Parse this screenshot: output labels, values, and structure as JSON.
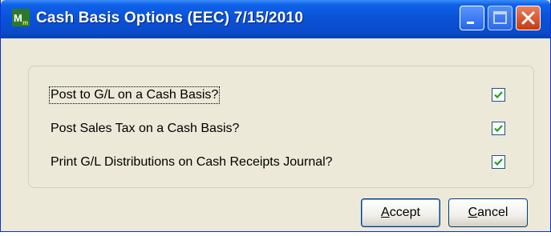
{
  "window": {
    "title": "Cash Basis Options (EEC) 7/15/2010",
    "icon": "mas-app-icon"
  },
  "options": [
    {
      "label": "Post to G/L on a Cash Basis?",
      "checked": true
    },
    {
      "label": "Post Sales Tax on a Cash Basis?",
      "checked": true
    },
    {
      "label": "Print G/L Distributions on Cash Receipts Journal?",
      "checked": true
    }
  ],
  "buttons": {
    "accept": {
      "mnemonic": "A",
      "rest": "ccept"
    },
    "cancel": {
      "mnemonic": "C",
      "rest": "ancel"
    }
  },
  "colors": {
    "titlebar": "#0a52d8",
    "dialog_bg": "#ece9d8",
    "check": "#21a121"
  }
}
